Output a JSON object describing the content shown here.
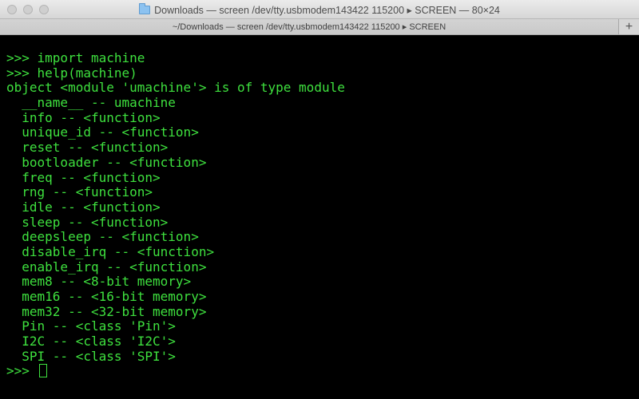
{
  "window": {
    "title": "Downloads — screen /dev/tty.usbmodem143422 115200 ▸ SCREEN — 80×24"
  },
  "tabbar": {
    "tab_label": "~/Downloads — screen /dev/tty.usbmodem143422 115200 ▸ SCREEN",
    "new_tab_symbol": "+"
  },
  "terminal": {
    "text_color": "#3ee03e",
    "background": "#000000",
    "lines": [
      ">>> import machine",
      ">>> help(machine)",
      "object <module 'umachine'> is of type module",
      "  __name__ -- umachine",
      "  info -- <function>",
      "  unique_id -- <function>",
      "  reset -- <function>",
      "  bootloader -- <function>",
      "  freq -- <function>",
      "  rng -- <function>",
      "  idle -- <function>",
      "  sleep -- <function>",
      "  deepsleep -- <function>",
      "  disable_irq -- <function>",
      "  enable_irq -- <function>",
      "  mem8 -- <8-bit memory>",
      "  mem16 -- <16-bit memory>",
      "  mem32 -- <32-bit memory>",
      "  Pin -- <class 'Pin'>",
      "  I2C -- <class 'I2C'>",
      "  SPI -- <class 'SPI'>"
    ],
    "prompt": ">>> "
  }
}
